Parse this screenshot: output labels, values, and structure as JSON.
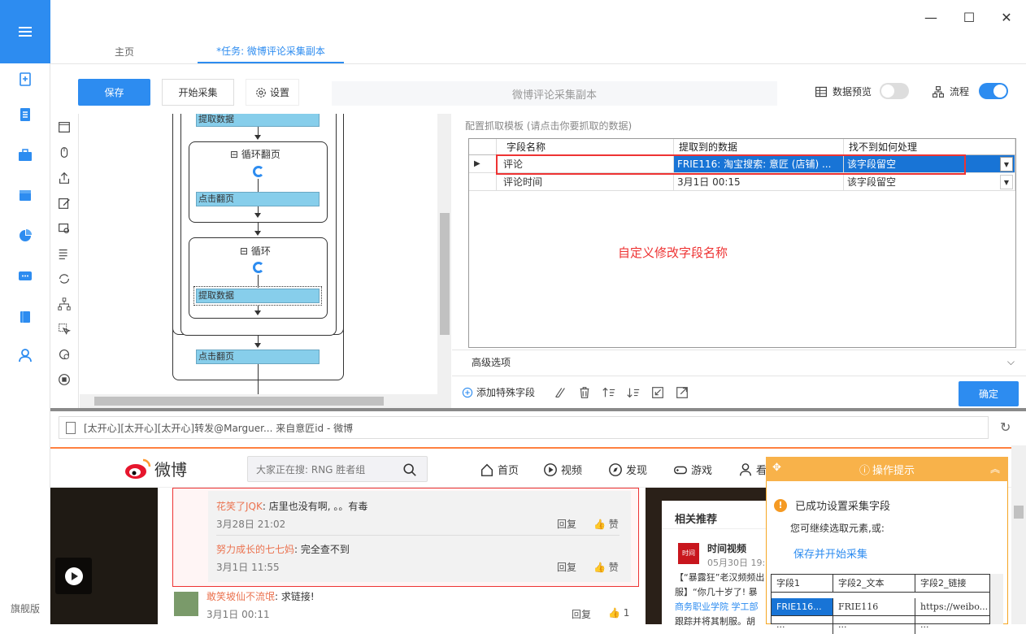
{
  "window": {
    "minimize": "—",
    "maximize": "☐",
    "close": "✕"
  },
  "nav": {
    "flagship": "旗舰版"
  },
  "tabs": {
    "home": "主页",
    "task": "*任务: 微博评论采集副本"
  },
  "toolbar": {
    "save": "保存",
    "start": "开始采集",
    "settings": "设置",
    "task_name": "微博评论采集副本",
    "data_preview": "数据预览",
    "flow": "流程"
  },
  "workflow": {
    "extract1": "提取数据",
    "loop_page": "循环翻页",
    "click_page1": "点击翻页",
    "loop": "循环",
    "extract2": "提取数据",
    "click_page2": "点击翻页"
  },
  "config": {
    "label": "配置抓取模板 (请点击你要抓取的数据)",
    "headers": [
      "字段名称",
      "提取到的数据",
      "找不到如何处理"
    ],
    "rows": [
      {
        "name": "评论",
        "data": "FRIE116: 淘宝搜索: 意匠 (店铺) ...",
        "handle": "该字段留空"
      },
      {
        "name": "评论时间",
        "data": "3月1日 00:15",
        "handle": "该字段留空"
      }
    ],
    "hint": "自定义修改字段名称",
    "advanced": "高级选项",
    "add_field": "添加特殊字段",
    "ok": "确定"
  },
  "browser": {
    "address": "[太开心][太开心][太开心]转发@Marguer... 来自意匠id - 微博"
  },
  "weibo": {
    "logo": "微博",
    "search_placeholder": "大家正在搜: RNG 胜者组",
    "nav": [
      "首页",
      "视频",
      "发现",
      "游戏",
      "看"
    ],
    "comments": [
      {
        "user": "花笑了JQK",
        "text": ": 店里也没有啊, 。。有毒",
        "time": "3月28日 21:02",
        "reply": "回复",
        "like": "赞"
      },
      {
        "user": "努力成长的七七妈",
        "text": ": 完全查不到",
        "time": "3月1日 11:55",
        "reply": "回复",
        "like": "赞"
      },
      {
        "user": "敢笑坡仙不流氓",
        "text": ": 求链接!",
        "time": "3月1日 00:11",
        "reply": "回复",
        "like": "1"
      }
    ],
    "related": {
      "title": "相关推荐",
      "source": "时间视频",
      "date": "05月30日 19:",
      "line1": "【“暴露狂”老汉频频出",
      "line2": "服】“你几十岁了! 暴",
      "line3": "商务职业学院 学工部",
      "line4": "跟踪并将其制服。胡"
    }
  },
  "popup": {
    "title": "操作提示",
    "msg": "已成功设置采集字段",
    "sub": "您可继续选取元素,或:",
    "link": "保存并开始采集",
    "headers": [
      "字段1",
      "字段2_文本",
      "字段2_链接"
    ],
    "row": [
      "FRIE116...",
      "FRIE116",
      "https://weibo..."
    ],
    "row2": [
      "...",
      "...",
      "..."
    ]
  },
  "colors": {
    "accent": "#2d8cf0",
    "highlight": "#e33",
    "weibo": "#ff8140"
  }
}
